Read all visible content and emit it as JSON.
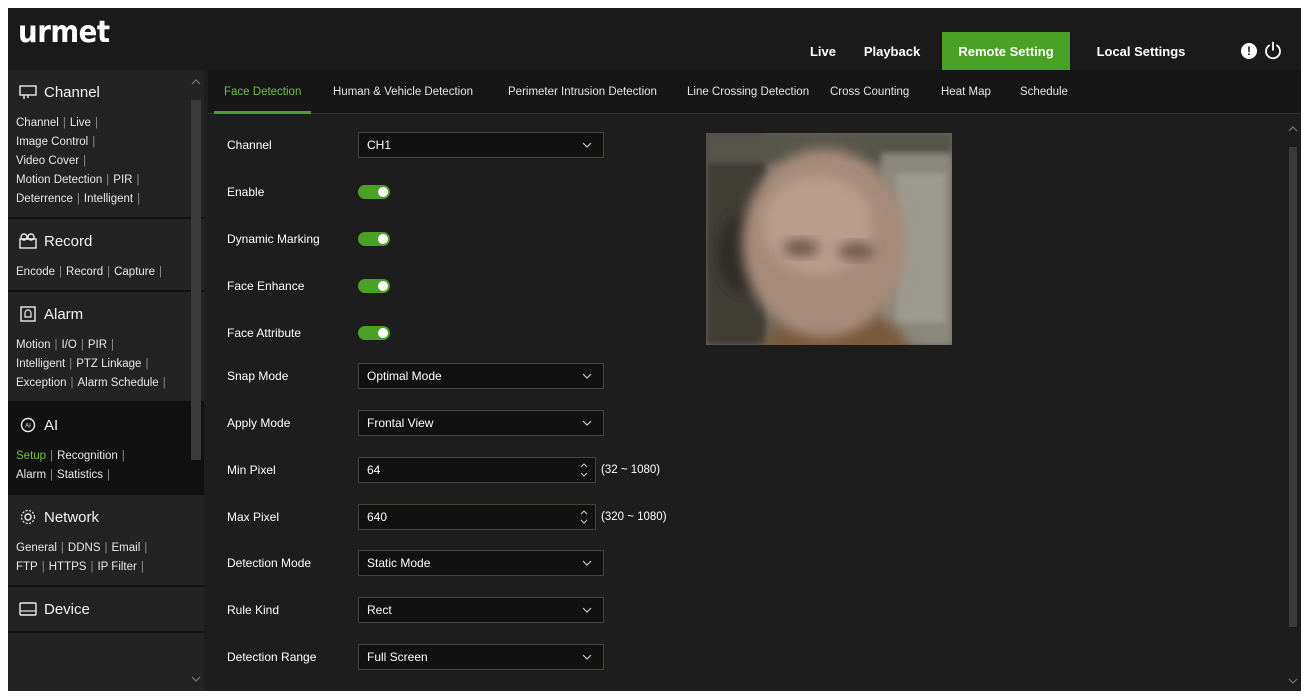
{
  "app": {
    "logo": "urmet"
  },
  "topnav": {
    "items": [
      {
        "label": "Live"
      },
      {
        "label": "Playback"
      },
      {
        "label": "Remote Setting"
      },
      {
        "label": "Local Settings"
      }
    ],
    "active_color": "#4aa125",
    "alert_glyph": "!"
  },
  "sidebar": {
    "sections": [
      {
        "title": "Channel",
        "icon": "channel-icon",
        "lines": [
          [
            "Channel",
            "Live"
          ],
          [
            "Image Control"
          ],
          [
            "Video Cover"
          ],
          [
            "Motion Detection",
            "PIR"
          ],
          [
            "Deterrence",
            "Intelligent"
          ]
        ]
      },
      {
        "title": "Record",
        "icon": "record-icon",
        "lines": [
          [
            "Encode",
            "Record",
            "Capture"
          ]
        ]
      },
      {
        "title": "Alarm",
        "icon": "alarm-icon",
        "lines": [
          [
            "Motion",
            "I/O",
            "PIR"
          ],
          [
            "Intelligent",
            "PTZ Linkage"
          ],
          [
            "Exception",
            "Alarm Schedule"
          ]
        ]
      },
      {
        "title": "AI",
        "icon": "ai-icon",
        "lines": [
          [
            "Setup",
            "Recognition"
          ],
          [
            "Alarm",
            "Statistics"
          ]
        ]
      },
      {
        "title": "Network",
        "icon": "network-icon",
        "lines": [
          [
            "General",
            "DDNS",
            "Email"
          ],
          [
            "FTP",
            "HTTPS",
            "IP Filter"
          ]
        ]
      },
      {
        "title": "Device",
        "icon": "device-icon",
        "lines": []
      }
    ],
    "current_section": "AI",
    "current_link": "Setup"
  },
  "tabs": [
    {
      "label": "Face Detection"
    },
    {
      "label": "Human & Vehicle Detection"
    },
    {
      "label": "Perimeter Intrusion Detection"
    },
    {
      "label": "Line Crossing Detection"
    },
    {
      "label": "Cross Counting"
    },
    {
      "label": "Heat Map"
    },
    {
      "label": "Schedule"
    }
  ],
  "form": {
    "channel": {
      "label": "Channel",
      "value": "CH1"
    },
    "enable": {
      "label": "Enable",
      "on": true
    },
    "dynamic_marking": {
      "label": "Dynamic Marking",
      "on": true
    },
    "face_enhance": {
      "label": "Face Enhance",
      "on": true
    },
    "face_attribute": {
      "label": "Face Attribute",
      "on": true
    },
    "snap_mode": {
      "label": "Snap Mode",
      "value": "Optimal Mode"
    },
    "apply_mode": {
      "label": "Apply Mode",
      "value": "Frontal View"
    },
    "min_pixel": {
      "label": "Min Pixel",
      "value": "64",
      "range": "(32 ~ 1080)"
    },
    "max_pixel": {
      "label": "Max Pixel",
      "value": "640",
      "range": "(320 ~ 1080)"
    },
    "detection_mode": {
      "label": "Detection Mode",
      "value": "Static Mode"
    },
    "rule_kind": {
      "label": "Rule Kind",
      "value": "Rect"
    },
    "detection_range": {
      "label": "Detection Range",
      "value": "Full Screen"
    }
  }
}
